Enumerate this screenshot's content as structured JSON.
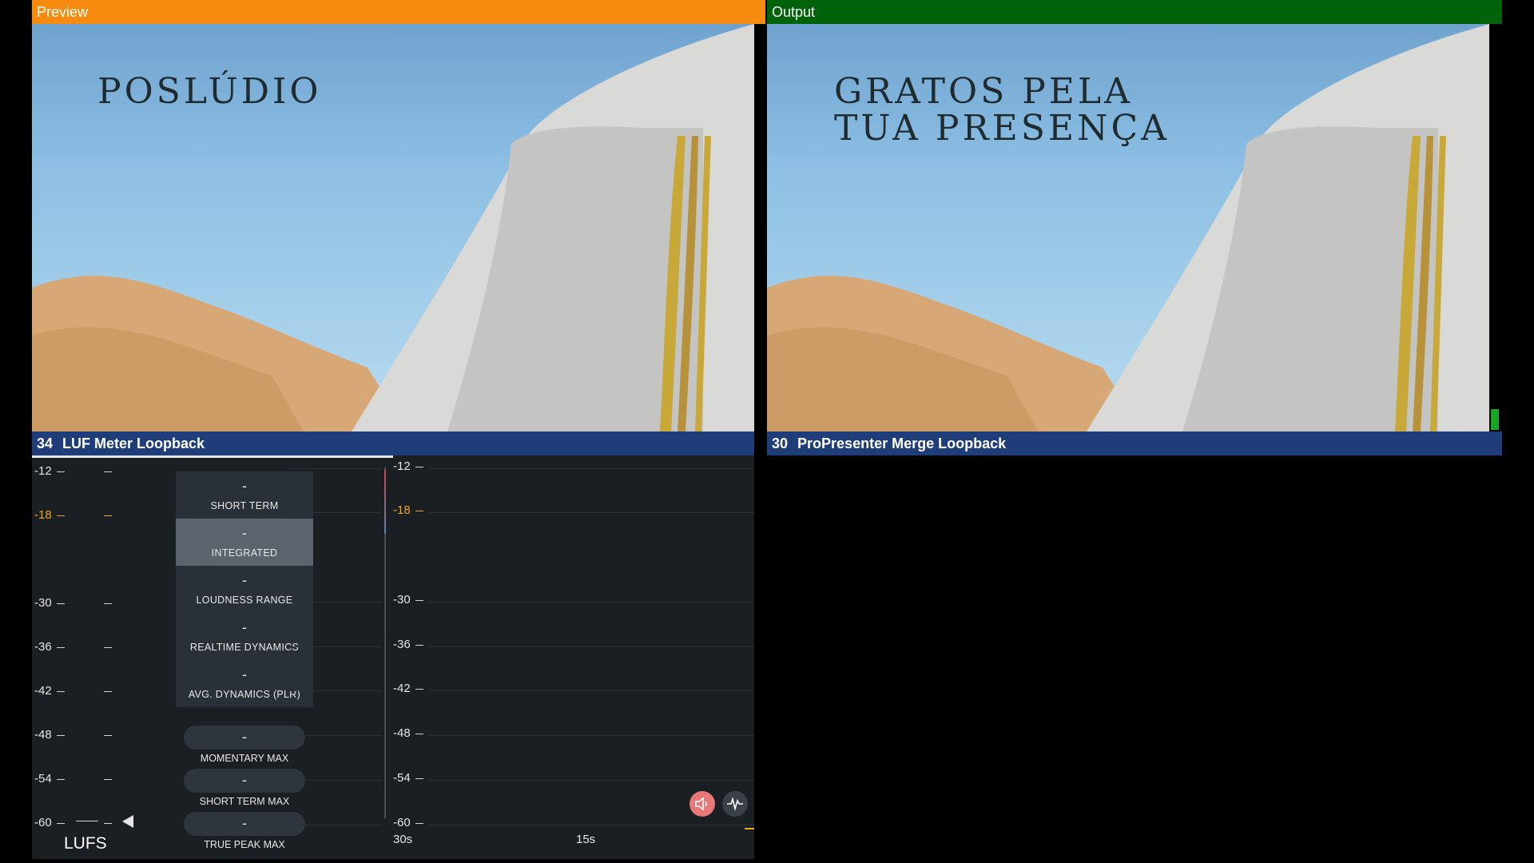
{
  "preview": {
    "header": "Preview",
    "slide_text": "POSLÚDIO"
  },
  "output": {
    "header": "Output",
    "slide_text": "GRATOS PELA\nTUA PRESENÇA"
  },
  "sources": [
    {
      "number": "34",
      "name": "LUF Meter Loopback"
    },
    {
      "number": "30",
      "name": "ProPresenter Merge Loopback"
    }
  ],
  "meter": {
    "left_scale": [
      "-12",
      "-18",
      "-30",
      "-36",
      "-42",
      "-48",
      "-54",
      "-60"
    ],
    "right_scale": [
      "-12",
      "-18",
      "-30",
      "-36",
      "-42",
      "-48",
      "-54",
      "-60"
    ],
    "unit": "LUFS",
    "stats": [
      {
        "value": "-",
        "label": "SHORT TERM"
      },
      {
        "value": "-",
        "label": "INTEGRATED"
      },
      {
        "value": "-",
        "label": "LOUDNESS RANGE"
      },
      {
        "value": "-",
        "label": "REALTIME DYNAMICS"
      },
      {
        "value": "-",
        "label": "AVG. DYNAMICS (PLR)"
      }
    ],
    "max_stats": [
      {
        "value": "-",
        "label": "MOMENTARY MAX"
      },
      {
        "value": "-",
        "label": "SHORT TERM MAX"
      },
      {
        "value": "-",
        "label": "TRUE PEAK MAX"
      }
    ],
    "time_labels": [
      "30s",
      "15s"
    ],
    "buttons": [
      "speaker-icon",
      "waveform-icon"
    ],
    "colors": {
      "warning": "#f0a71e",
      "preview": "#f68b0f",
      "output": "#006209",
      "source_bar": "#1f3d78"
    }
  }
}
